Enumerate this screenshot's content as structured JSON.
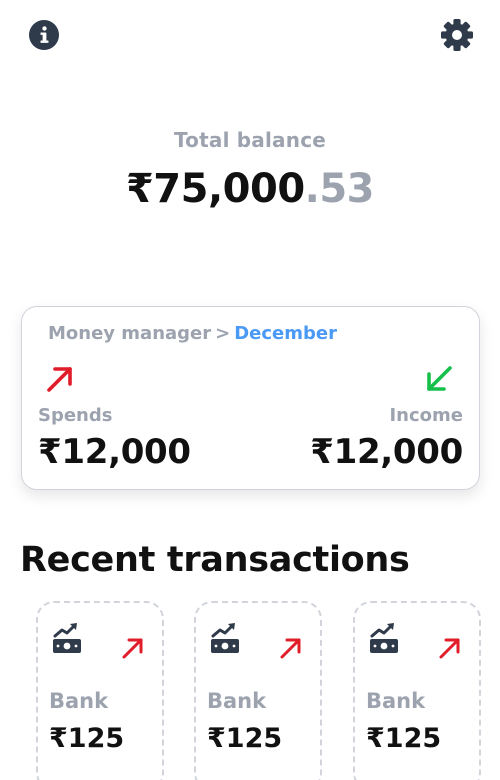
{
  "header": {
    "info_icon": "info-circle-icon",
    "settings_icon": "gear-icon"
  },
  "balance": {
    "label": "Total balance",
    "amount_main": "₹75,000",
    "amount_decimal": ".53"
  },
  "money_manager": {
    "title": "Money manager",
    "separator": ">",
    "month": "December",
    "spends": {
      "label": "Spends",
      "amount": "₹12,000",
      "icon": "arrow-up-right-icon",
      "color": "#e11d2a"
    },
    "income": {
      "label": "Income",
      "amount": "₹12,000",
      "icon": "arrow-down-left-icon",
      "color": "#16c04a"
    }
  },
  "recent": {
    "title": "Recent transactions",
    "items": [
      {
        "source": "Bank",
        "amount": "₹125",
        "icon": "money-trend-icon",
        "direction_icon": "arrow-up-right-icon"
      },
      {
        "source": "Bank",
        "amount": "₹125",
        "icon": "money-trend-icon",
        "direction_icon": "arrow-up-right-icon"
      },
      {
        "source": "Bank",
        "amount": "₹125",
        "icon": "money-trend-icon",
        "direction_icon": "arrow-up-right-icon"
      }
    ]
  },
  "colors": {
    "muted": "#9ca3af",
    "accent": "#4a9af5",
    "dark": "#111111",
    "icon": "#2f3a4a"
  }
}
